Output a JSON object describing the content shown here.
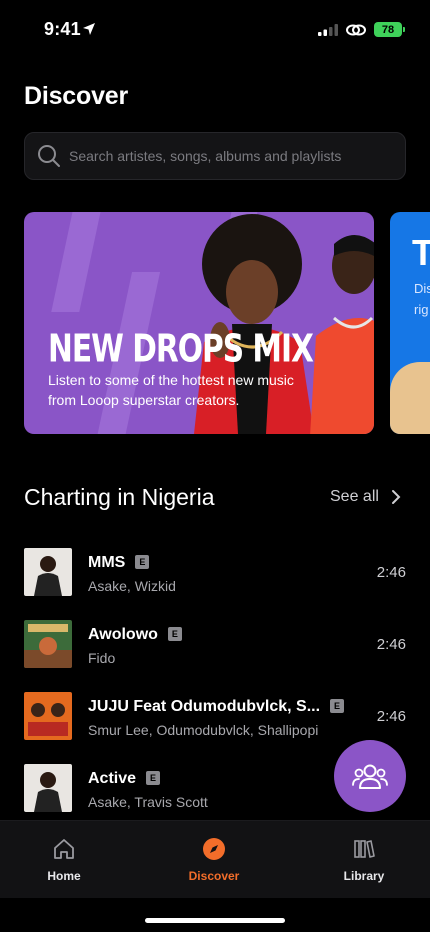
{
  "status_bar": {
    "time": "9:41",
    "battery": "78"
  },
  "page": {
    "title": "Discover"
  },
  "search": {
    "placeholder": "Search artistes, songs, albums and playlists",
    "value": ""
  },
  "banners": [
    {
      "title": "NEW DROPS MIX",
      "description": "Listen to some of the hottest new music from Looop superstar creators."
    },
    {
      "title_partial": "T",
      "description_partial": "Dis\nrig"
    }
  ],
  "chart_section": {
    "title": "Charting in Nigeria",
    "see_all_label": "See all"
  },
  "tracks": [
    {
      "title": "MMS",
      "explicit": "E",
      "artists": "Asake, Wizkid",
      "duration": "2:46"
    },
    {
      "title": "Awolowo",
      "explicit": "E",
      "artists": "Fido",
      "duration": "2:46"
    },
    {
      "title": "JUJU Feat Odumodubvlck, S...",
      "explicit": "E",
      "artists": "Smur Lee, Odumodubvlck, Shallipopi",
      "duration": "2:46"
    },
    {
      "title": "Active",
      "explicit": "E",
      "artists": "Asake, Travis Scott",
      "duration": ""
    }
  ],
  "tabbar": {
    "items": [
      {
        "label": "Home",
        "icon": "home-icon"
      },
      {
        "label": "Discover",
        "icon": "compass-icon"
      },
      {
        "label": "Library",
        "icon": "library-icon"
      }
    ],
    "active": "Discover"
  },
  "colors": {
    "accent_purple": "#8b55c7",
    "active_tab": "#f26d2a",
    "battery_green": "#3fd15a"
  }
}
